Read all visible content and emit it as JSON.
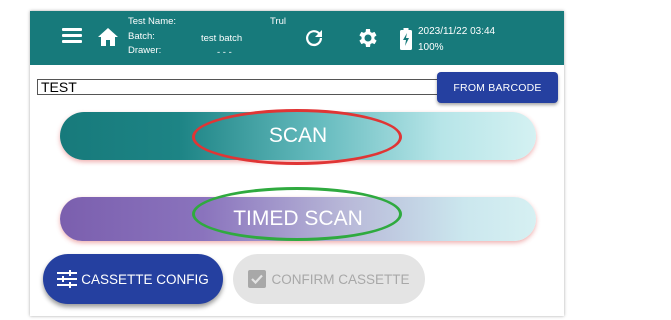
{
  "header": {
    "test_name_label": "Test Name:",
    "test_name_value": "Trul",
    "batch_label": "Batch:",
    "batch_value": "test batch",
    "drawer_label": "Drawer:",
    "drawer_value": "- - -",
    "datetime": "2023/11/22 03:44",
    "battery": "100%"
  },
  "icons": {
    "menu": "menu-icon",
    "home": "home-icon",
    "refresh": "refresh-icon",
    "settings": "gear-icon",
    "battery": "battery-charging-icon",
    "cassette": "tune-icon",
    "confirm": "checkbox-icon"
  },
  "input": {
    "value": "TEST"
  },
  "buttons": {
    "from_barcode": "FROM BARCODE",
    "scan": "SCAN",
    "timed_scan": "TIMED SCAN",
    "cassette_config": "CASSETTE CONFIG",
    "confirm_cassette": "CONFIRM CASSETTE"
  },
  "colors": {
    "appbar": "#177a7b",
    "primary_button": "#2540a0",
    "annotation_red": "#e03535",
    "annotation_green": "#2faa3f"
  }
}
